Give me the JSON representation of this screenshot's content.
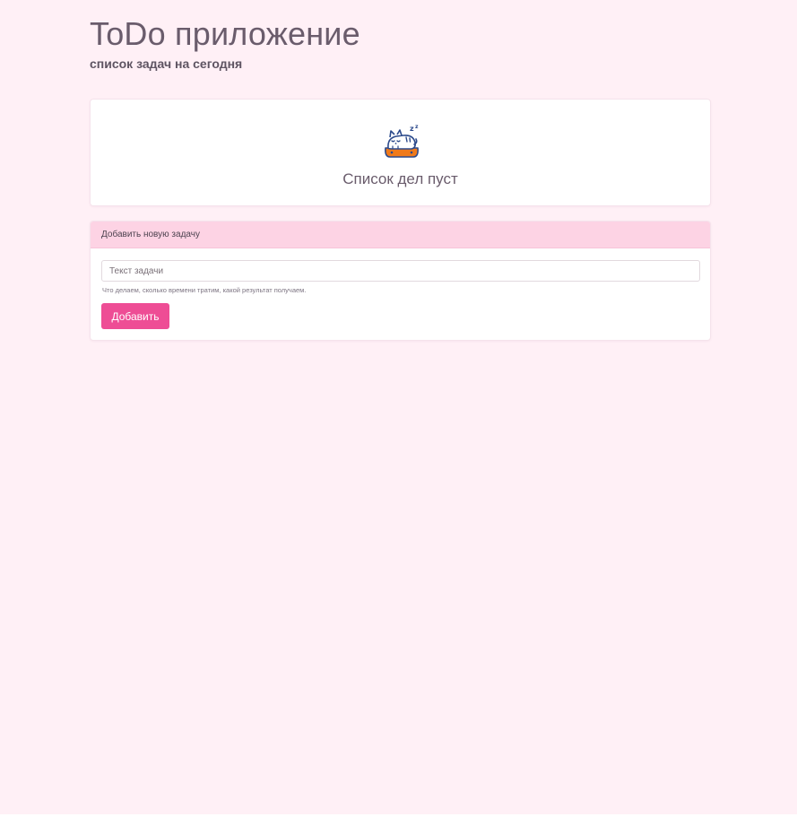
{
  "header": {
    "title": "ToDo приложение",
    "subtitle": "список задач на сегодня"
  },
  "empty_state": {
    "icon": "sleeping-cat-icon",
    "message": "Список дел пуст"
  },
  "add_task": {
    "header_label": "Добавить новую задачу",
    "input_value": "",
    "input_placeholder": "Текст задачи",
    "help_text": "Что делаем, сколько времени тратим, какой результат получаем.",
    "button_label": "Добавить"
  },
  "colors": {
    "page_background": "#fff0f6",
    "card_header": "#fdd3e4",
    "accent": "#ee4d95",
    "icon_primary": "#2c4a8c",
    "icon_secondary": "#f07a1a"
  }
}
